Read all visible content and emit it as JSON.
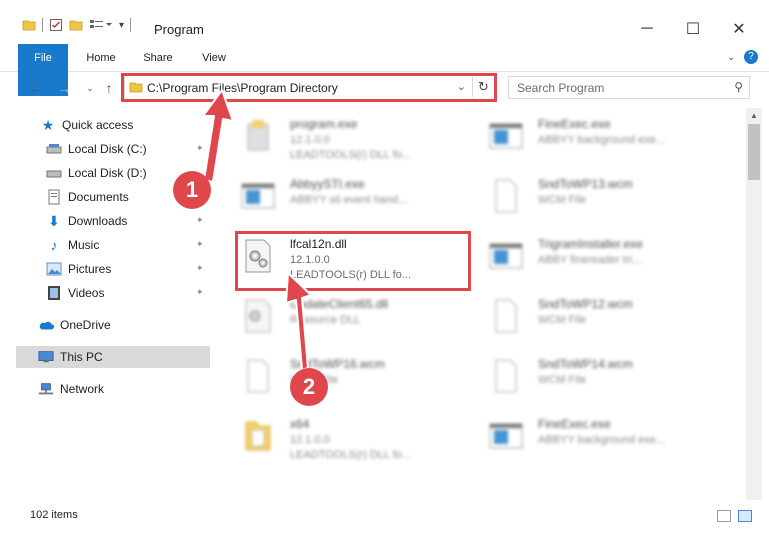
{
  "window": {
    "title": "Program"
  },
  "ribbon": {
    "tabs": [
      "File",
      "Home",
      "Share",
      "View"
    ]
  },
  "address": {
    "path": "C:\\Program Files\\Program Directory"
  },
  "search": {
    "placeholder": "Search Program"
  },
  "sidebar": {
    "items": [
      {
        "label": "Quick access",
        "icon": "star-icon"
      },
      {
        "label": "Local Disk (C:)",
        "icon": "drive-icon"
      },
      {
        "label": "Local Disk (D:)",
        "icon": "drive-icon"
      },
      {
        "label": "Documents",
        "icon": "documents-icon"
      },
      {
        "label": "Downloads",
        "icon": "download-icon"
      },
      {
        "label": "Music",
        "icon": "music-icon"
      },
      {
        "label": "Pictures",
        "icon": "pictures-icon"
      },
      {
        "label": "Videos",
        "icon": "videos-icon"
      },
      {
        "label": "OneDrive",
        "icon": "cloud-icon"
      },
      {
        "label": "This PC",
        "icon": "computer-icon"
      },
      {
        "label": "Network",
        "icon": "network-icon"
      }
    ]
  },
  "files": [
    {
      "name": "program.exe",
      "l2": "12.1.0.0",
      "l3": "LEADTOOLS(r) DLL fo...",
      "icon": "setup-exe-icon"
    },
    {
      "name": "FineExec.exe",
      "l2": "ABBYY background exe...",
      "l3": "",
      "icon": "window-exe-icon"
    },
    {
      "name": "AbbyySTI.exe",
      "l2": "ABBYY sti event hand...",
      "l3": "",
      "icon": "window-exe-icon"
    },
    {
      "name": "SndToWP13.wcm",
      "l2": "WCM File",
      "l3": "",
      "icon": "blank-file-icon"
    },
    {
      "name": "lfcal12n.dll",
      "l2": "12.1.0.0",
      "l3": "LEADTOOLS(r) DLL fo...",
      "icon": "dll-gear-icon"
    },
    {
      "name": "TrigramInstaller.exe",
      "l2": "ABBY finereader tri...",
      "l3": "",
      "icon": "window-exe-icon"
    },
    {
      "name": "UpdateClient65.dll",
      "l2": "Resource DLL",
      "l3": "",
      "icon": "dll-gear-icon"
    },
    {
      "name": "SndToWP12.wcm",
      "l2": "WCM File",
      "l3": "",
      "icon": "blank-file-icon"
    },
    {
      "name": "SndToWP16.wcm",
      "l2": "WCM File",
      "l3": "",
      "icon": "blank-file-icon"
    },
    {
      "name": "SndToWP14.wcm",
      "l2": "WCM File",
      "l3": "",
      "icon": "blank-file-icon"
    },
    {
      "name": "x64",
      "l2": "12.1.0.0",
      "l3": "LEADTOOLS(r) DLL fo...",
      "icon": "folder-icon"
    },
    {
      "name": "FineExec.exe",
      "l2": "ABBYY background exe...",
      "l3": "",
      "icon": "window-exe-icon"
    }
  ],
  "status": {
    "count": "102 items"
  },
  "callouts": {
    "one": "1",
    "two": "2"
  },
  "colors": {
    "accent": "#1979ca",
    "highlight": "#e0474c",
    "selected": "#d9d9d9"
  }
}
